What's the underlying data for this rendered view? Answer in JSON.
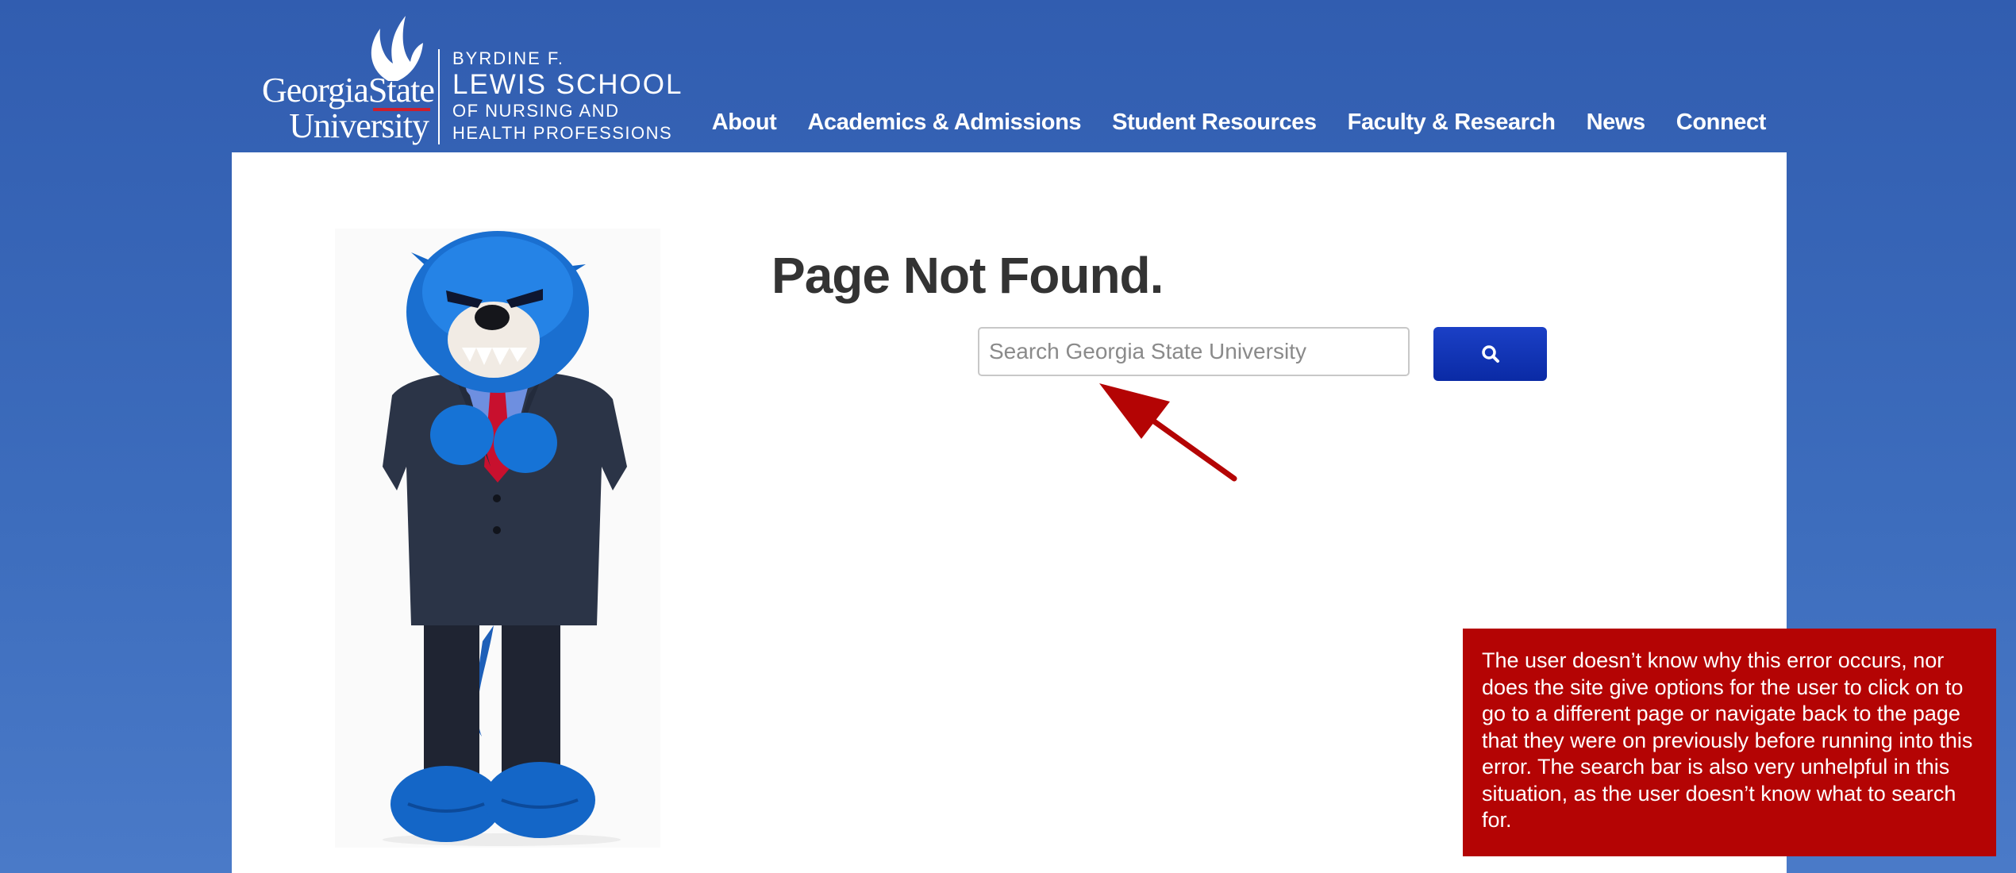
{
  "header": {
    "logo": {
      "wordmark_line1": "GeorgiaState",
      "wordmark_line2": "University",
      "school_line1": "BYRDINE F.",
      "school_line2": "LEWIS SCHOOL",
      "school_line3": "OF NURSING AND",
      "school_line4": "HEALTH PROFESSIONS"
    },
    "nav": [
      {
        "label": "About"
      },
      {
        "label": "Academics & Admissions"
      },
      {
        "label": "Student Resources"
      },
      {
        "label": "Faculty & Research"
      },
      {
        "label": "News"
      },
      {
        "label": "Connect"
      }
    ]
  },
  "main": {
    "title": "Page Not Found.",
    "search": {
      "placeholder": "Search Georgia State University",
      "value": "",
      "button_icon": "search-icon"
    },
    "mascot": "panther-mascot-in-suit"
  },
  "annotation": {
    "text": "The user doesn’t know why this error occurs, nor does the site give options for the user to click on to go to a different page or navigate back to the page that they were on previously before running into this error. The search bar is also very unhelpful in this situation, as the user doesn’t know what to search for."
  },
  "colors": {
    "background": "#3a66b8",
    "panel": "#ffffff",
    "search_button": "#0a2aa5",
    "callout": "#b40404",
    "title_text": "#333333"
  }
}
